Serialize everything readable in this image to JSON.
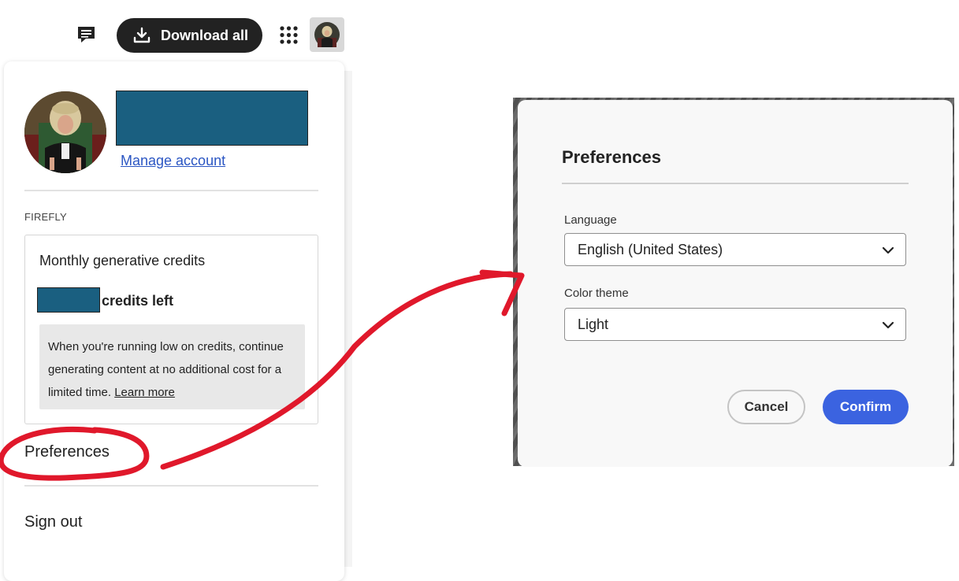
{
  "toolbar": {
    "download_label": "Download all",
    "icons": [
      "chat-icon",
      "download-icon",
      "apps-grid-icon",
      "user-avatar"
    ]
  },
  "account_menu": {
    "manage_account": "Manage account",
    "section_label": "FIREFLY",
    "credits": {
      "title": "Monthly generative credits",
      "left_label": "credits left",
      "info_text": "When you're running low on credits, continue generating content at no additional cost for a limited time.",
      "learn_more": "Learn more"
    },
    "preferences": "Preferences",
    "sign_out": "Sign out"
  },
  "preferences_dialog": {
    "title": "Preferences",
    "language_label": "Language",
    "language_value": "English (United States)",
    "theme_label": "Color theme",
    "theme_value": "Light",
    "cancel": "Cancel",
    "confirm": "Confirm"
  },
  "colors": {
    "redaction": "#1a5f80",
    "accent_blue": "#3b63e0",
    "annotation_red": "#e0182b",
    "link": "#2b56c3"
  }
}
